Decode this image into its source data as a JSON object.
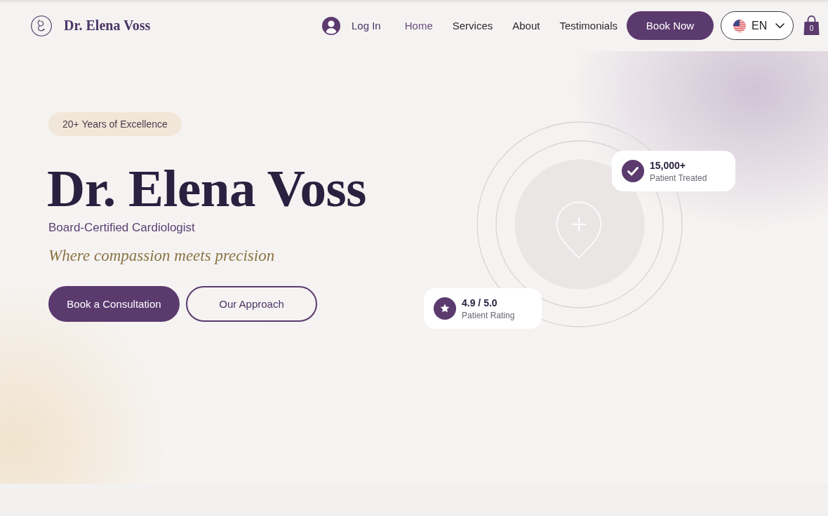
{
  "header": {
    "brand": "Dr. Elena Voss",
    "login": "Log In",
    "nav": [
      {
        "label": "Home",
        "selected": true
      },
      {
        "label": "Services",
        "selected": false
      },
      {
        "label": "About",
        "selected": false
      },
      {
        "label": "Testimonials",
        "selected": false
      }
    ],
    "cta": "Book Now",
    "language": "EN",
    "cart_count": "0"
  },
  "hero": {
    "badge": "20+ Years of Excellence",
    "title": "Dr. Elena Voss",
    "subtitle": "Board-Certified Cardiologist",
    "tagline": "Where compassion meets precision",
    "buttons": [
      {
        "label": "Book a Consultation",
        "kind": "primary"
      },
      {
        "label": "Our Approach",
        "kind": "outline"
      }
    ],
    "stats": [
      {
        "kind": "check",
        "value": "15,000+",
        "label": "Patient Treated"
      },
      {
        "kind": "star",
        "value": "4.9 / 5.0",
        "label": "Patient Rating"
      }
    ]
  }
}
